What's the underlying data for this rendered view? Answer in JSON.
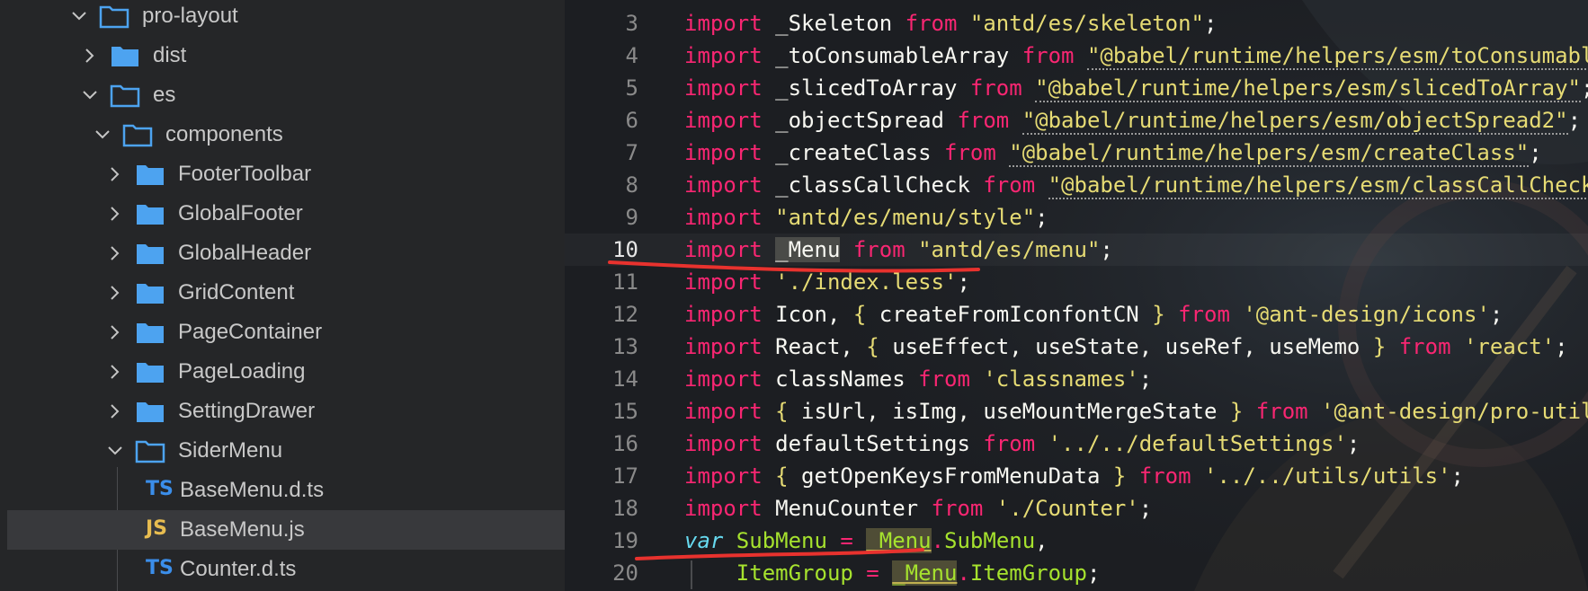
{
  "explorer": {
    "items": [
      {
        "label": "pro-layout",
        "kind": "folder",
        "state": "open"
      },
      {
        "label": "dist",
        "kind": "folder",
        "state": "closed"
      },
      {
        "label": "es",
        "kind": "folder",
        "state": "open"
      },
      {
        "label": "components",
        "kind": "folder",
        "state": "open"
      },
      {
        "label": "FooterToolbar",
        "kind": "folder",
        "state": "closed"
      },
      {
        "label": "GlobalFooter",
        "kind": "folder",
        "state": "closed"
      },
      {
        "label": "GlobalHeader",
        "kind": "folder",
        "state": "closed"
      },
      {
        "label": "GridContent",
        "kind": "folder",
        "state": "closed"
      },
      {
        "label": "PageContainer",
        "kind": "folder",
        "state": "closed"
      },
      {
        "label": "PageLoading",
        "kind": "folder",
        "state": "closed"
      },
      {
        "label": "SettingDrawer",
        "kind": "folder",
        "state": "closed"
      },
      {
        "label": "SiderMenu",
        "kind": "folder",
        "state": "open"
      },
      {
        "label": "BaseMenu.d.ts",
        "kind": "file",
        "badge": "TS"
      },
      {
        "label": "BaseMenu.js",
        "kind": "file",
        "badge": "JS",
        "selected": true
      },
      {
        "label": "Counter.d.ts",
        "kind": "file",
        "badge": "TS"
      }
    ]
  },
  "editor": {
    "current_line": "10",
    "lines": [
      {
        "n": "3",
        "t": [
          [
            "kw",
            "import"
          ],
          [
            "id",
            " _Skeleton "
          ],
          [
            "kw",
            "from"
          ],
          [
            "str",
            " \"antd/es/skeleton\""
          ],
          [
            "punc",
            ";"
          ]
        ]
      },
      {
        "n": "4",
        "t": [
          [
            "kw",
            "import"
          ],
          [
            "id",
            " _toConsumableArray "
          ],
          [
            "kw",
            "from"
          ],
          [
            "punc",
            " "
          ],
          [
            "str",
            "\"@babel/runtime/helpers/esm/toConsumabl"
          ]
        ]
      },
      {
        "n": "5",
        "t": [
          [
            "kw",
            "import"
          ],
          [
            "id",
            " _slicedToArray "
          ],
          [
            "kw",
            "from"
          ],
          [
            "punc",
            " "
          ],
          [
            "str",
            "\"@babel/runtime/helpers/esm/slicedToArray\""
          ],
          [
            "punc",
            ";"
          ]
        ]
      },
      {
        "n": "6",
        "t": [
          [
            "kw",
            "import"
          ],
          [
            "id",
            " _objectSpread "
          ],
          [
            "kw",
            "from"
          ],
          [
            "punc",
            " "
          ],
          [
            "str",
            "\"@babel/runtime/helpers/esm/objectSpread2\""
          ],
          [
            "punc",
            ";"
          ]
        ]
      },
      {
        "n": "7",
        "t": [
          [
            "kw",
            "import"
          ],
          [
            "id",
            " _createClass "
          ],
          [
            "kw",
            "from"
          ],
          [
            "punc",
            " "
          ],
          [
            "str",
            "\"@babel/runtime/helpers/esm/createClass\""
          ],
          [
            "punc",
            ";"
          ]
        ]
      },
      {
        "n": "8",
        "t": [
          [
            "kw",
            "import"
          ],
          [
            "id",
            " _classCallCheck "
          ],
          [
            "kw",
            "from"
          ],
          [
            "punc",
            " "
          ],
          [
            "str",
            "\"@babel/runtime/helpers/esm/classCallCheck"
          ]
        ]
      },
      {
        "n": "9",
        "t": [
          [
            "kw",
            "import"
          ],
          [
            "str",
            " \"antd/es/menu/style\""
          ],
          [
            "punc",
            ";"
          ]
        ]
      },
      {
        "n": "10",
        "t": [
          [
            "kw",
            "import"
          ],
          [
            "id",
            " "
          ],
          [
            "id",
            "_Menu"
          ],
          [
            "id",
            " "
          ],
          [
            "kw",
            "from"
          ],
          [
            "str",
            " \"antd/es/menu\""
          ],
          [
            "punc",
            ";"
          ]
        ]
      },
      {
        "n": "11",
        "t": [
          [
            "kw",
            "import"
          ],
          [
            "str",
            " './index.less'"
          ],
          [
            "punc",
            ";"
          ]
        ]
      },
      {
        "n": "12",
        "t": [
          [
            "kw",
            "import"
          ],
          [
            "id",
            " Icon, "
          ],
          [
            "brace",
            "{"
          ],
          [
            "id",
            " createFromIconfontCN "
          ],
          [
            "brace",
            "}"
          ],
          [
            "id",
            " "
          ],
          [
            "kw",
            "from"
          ],
          [
            "str",
            " '@ant-design/icons'"
          ],
          [
            "punc",
            ";"
          ]
        ]
      },
      {
        "n": "13",
        "t": [
          [
            "kw",
            "import"
          ],
          [
            "id",
            " React, "
          ],
          [
            "brace",
            "{"
          ],
          [
            "id",
            " useEffect, useState, useRef, useMemo "
          ],
          [
            "brace",
            "}"
          ],
          [
            "id",
            " "
          ],
          [
            "kw",
            "from"
          ],
          [
            "str",
            " 'react'"
          ],
          [
            "punc",
            ";"
          ]
        ]
      },
      {
        "n": "14",
        "t": [
          [
            "kw",
            "import"
          ],
          [
            "id",
            " classNames "
          ],
          [
            "kw",
            "from"
          ],
          [
            "str",
            " 'classnames'"
          ],
          [
            "punc",
            ";"
          ]
        ]
      },
      {
        "n": "15",
        "t": [
          [
            "kw",
            "import"
          ],
          [
            "id",
            " "
          ],
          [
            "brace",
            "{"
          ],
          [
            "id",
            " isUrl, isImg, useMountMergeState "
          ],
          [
            "brace",
            "}"
          ],
          [
            "id",
            " "
          ],
          [
            "kw",
            "from"
          ],
          [
            "str",
            " '@ant-design/pro-util"
          ]
        ]
      },
      {
        "n": "16",
        "t": [
          [
            "kw",
            "import"
          ],
          [
            "id",
            " defaultSettings "
          ],
          [
            "kw",
            "from"
          ],
          [
            "str",
            " '../../defaultSettings'"
          ],
          [
            "punc",
            ";"
          ]
        ]
      },
      {
        "n": "17",
        "t": [
          [
            "kw",
            "import"
          ],
          [
            "id",
            " "
          ],
          [
            "brace",
            "{"
          ],
          [
            "id",
            " getOpenKeysFromMenuData "
          ],
          [
            "brace",
            "}"
          ],
          [
            "id",
            " "
          ],
          [
            "kw",
            "from"
          ],
          [
            "str",
            " '../../utils/utils'"
          ],
          [
            "punc",
            ";"
          ]
        ]
      },
      {
        "n": "18",
        "t": [
          [
            "kw",
            "import"
          ],
          [
            "id",
            " MenuCounter "
          ],
          [
            "kw",
            "from"
          ],
          [
            "str",
            " './Counter'"
          ],
          [
            "punc",
            ";"
          ]
        ]
      },
      {
        "n": "19",
        "t": [
          [
            "var-kw",
            "var"
          ],
          [
            "green",
            " SubMenu"
          ],
          [
            "kw",
            " = "
          ],
          [
            "green",
            "_Menu"
          ],
          [
            "kw",
            "."
          ],
          [
            "green",
            "SubMenu"
          ],
          [
            "punc",
            ","
          ]
        ]
      },
      {
        "n": "20",
        "t": [
          [
            "green",
            "    ItemGroup"
          ],
          [
            "kw",
            " = "
          ],
          [
            "green",
            "_Menu"
          ],
          [
            "kw",
            "."
          ],
          [
            "green",
            "ItemGroup"
          ],
          [
            "punc",
            ";"
          ]
        ]
      }
    ]
  }
}
